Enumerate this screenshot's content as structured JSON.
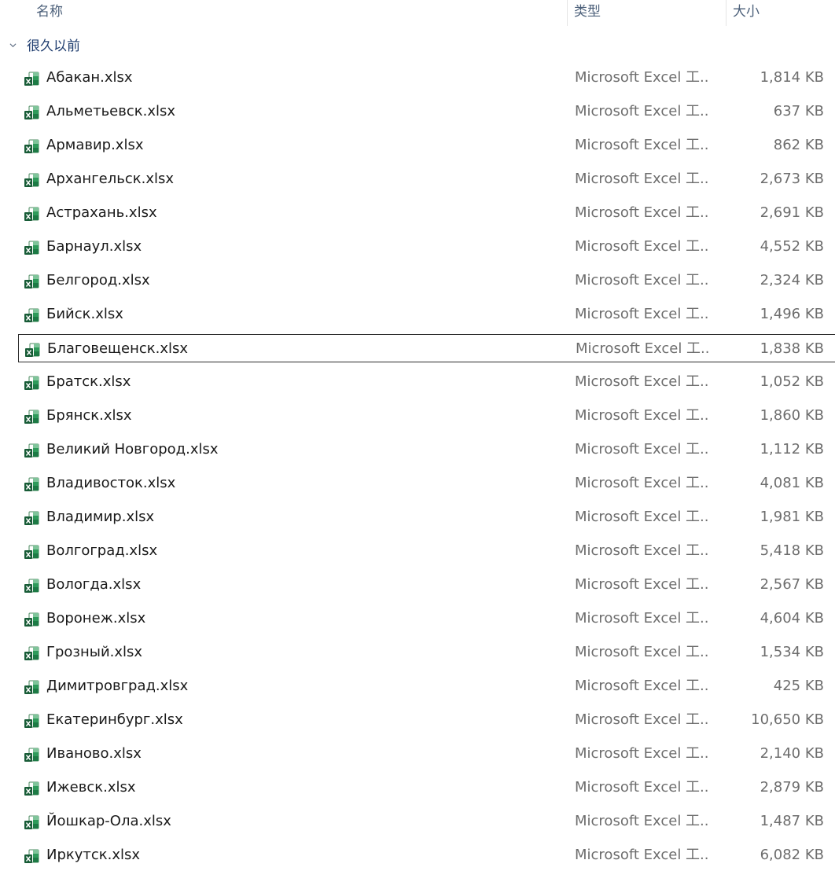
{
  "columns": {
    "name": "名称",
    "type": "类型",
    "size": "大小"
  },
  "group": {
    "label": "很久以前",
    "icon": "chevron-down-icon"
  },
  "file_icon": "excel-file-icon",
  "colors": {
    "excel_green": "#1d7a45",
    "excel_dark": "#185c37",
    "header_text": "#4c607a",
    "group_text": "#1e3c6e",
    "secondary_text": "#6d6d6d"
  },
  "selected_index": 8,
  "files": [
    {
      "name": "Абакан.xlsx",
      "type": "Microsoft Excel 工...",
      "size": "1,814 KB"
    },
    {
      "name": "Альметьевск.xlsx",
      "type": "Microsoft Excel 工...",
      "size": "637 KB"
    },
    {
      "name": "Армавир.xlsx",
      "type": "Microsoft Excel 工...",
      "size": "862 KB"
    },
    {
      "name": "Архангельск.xlsx",
      "type": "Microsoft Excel 工...",
      "size": "2,673 KB"
    },
    {
      "name": "Астрахань.xlsx",
      "type": "Microsoft Excel 工...",
      "size": "2,691 KB"
    },
    {
      "name": "Барнаул.xlsx",
      "type": "Microsoft Excel 工...",
      "size": "4,552 KB"
    },
    {
      "name": "Белгород.xlsx",
      "type": "Microsoft Excel 工...",
      "size": "2,324 KB"
    },
    {
      "name": "Бийск.xlsx",
      "type": "Microsoft Excel 工...",
      "size": "1,496 KB"
    },
    {
      "name": "Благовещенск.xlsx",
      "type": "Microsoft Excel 工...",
      "size": "1,838 KB"
    },
    {
      "name": "Братск.xlsx",
      "type": "Microsoft Excel 工...",
      "size": "1,052 KB"
    },
    {
      "name": "Брянск.xlsx",
      "type": "Microsoft Excel 工...",
      "size": "1,860 KB"
    },
    {
      "name": "Великий Новгород.xlsx",
      "type": "Microsoft Excel 工...",
      "size": "1,112 KB"
    },
    {
      "name": "Владивосток.xlsx",
      "type": "Microsoft Excel 工...",
      "size": "4,081 KB"
    },
    {
      "name": "Владимир.xlsx",
      "type": "Microsoft Excel 工...",
      "size": "1,981 KB"
    },
    {
      "name": "Волгоград.xlsx",
      "type": "Microsoft Excel 工...",
      "size": "5,418 KB"
    },
    {
      "name": "Вологда.xlsx",
      "type": "Microsoft Excel 工...",
      "size": "2,567 KB"
    },
    {
      "name": "Воронеж.xlsx",
      "type": "Microsoft Excel 工...",
      "size": "4,604 KB"
    },
    {
      "name": "Грозный.xlsx",
      "type": "Microsoft Excel 工...",
      "size": "1,534 KB"
    },
    {
      "name": "Димитровград.xlsx",
      "type": "Microsoft Excel 工...",
      "size": "425 KB"
    },
    {
      "name": "Екатеринбург.xlsx",
      "type": "Microsoft Excel 工...",
      "size": "10,650 KB"
    },
    {
      "name": "Иваново.xlsx",
      "type": "Microsoft Excel 工...",
      "size": "2,140 KB"
    },
    {
      "name": "Ижевск.xlsx",
      "type": "Microsoft Excel 工...",
      "size": "2,879 KB"
    },
    {
      "name": "Йошкар-Ола.xlsx",
      "type": "Microsoft Excel 工...",
      "size": "1,487 KB"
    },
    {
      "name": "Иркутск.xlsx",
      "type": "Microsoft Excel 工...",
      "size": "6,082 KB"
    }
  ]
}
